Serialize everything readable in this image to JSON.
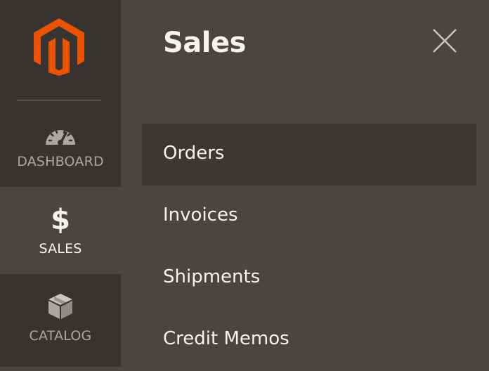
{
  "colors": {
    "sidebar_bg": "#373330",
    "panel_bg": "#4a4542",
    "active_item_bg": "#3b3734",
    "logo_orange": "#eb5202",
    "text_light": "#f7f3eb",
    "text_muted": "#aaa6a0"
  },
  "sidebar": {
    "logo_icon": "magento-logo",
    "items": [
      {
        "label": "DASHBOARD",
        "icon": "gauge-icon",
        "active": false
      },
      {
        "label": "SALES",
        "icon": "dollar-icon",
        "glyph": "$",
        "active": true
      },
      {
        "label": "CATALOG",
        "icon": "box-icon",
        "active": false
      }
    ]
  },
  "panel": {
    "title": "Sales",
    "close_icon": "close-icon",
    "items": [
      {
        "label": "Orders",
        "active": true
      },
      {
        "label": "Invoices",
        "active": false
      },
      {
        "label": "Shipments",
        "active": false
      },
      {
        "label": "Credit Memos",
        "active": false
      }
    ]
  }
}
